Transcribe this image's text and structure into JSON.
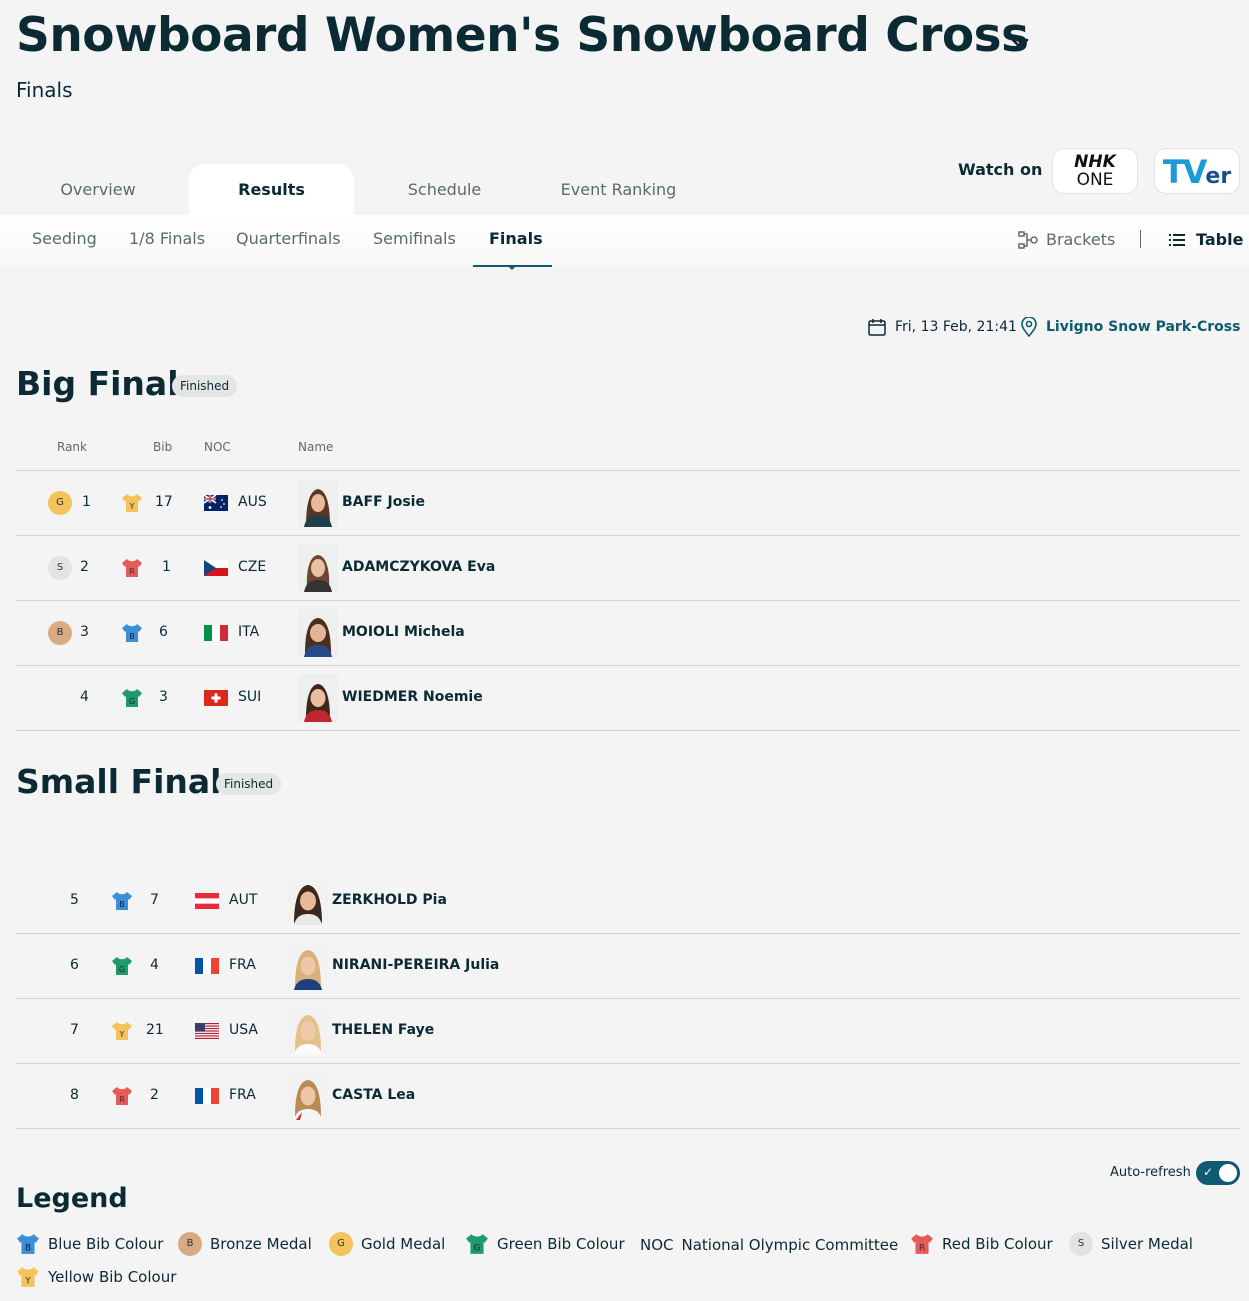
{
  "header": {
    "title": "Snowboard Women's Snowboard Cross",
    "subtitle": "Finals"
  },
  "tabs": [
    {
      "label": "Overview",
      "active": false
    },
    {
      "label": "Results",
      "active": true
    },
    {
      "label": "Schedule",
      "active": false
    },
    {
      "label": "Event Ranking",
      "active": false
    }
  ],
  "watch": {
    "label": "Watch on",
    "nhk_line1": "NHK",
    "nhk_line2": "ONE",
    "tver_t": "TV",
    "tver_er": "er"
  },
  "subtabs": [
    {
      "label": "Seeding",
      "active": false
    },
    {
      "label": "1/8 Finals",
      "active": false
    },
    {
      "label": "Quarterfinals",
      "active": false
    },
    {
      "label": "Semifinals",
      "active": false
    },
    {
      "label": "Finals",
      "active": true
    }
  ],
  "views": {
    "brackets": "Brackets",
    "table": "Table"
  },
  "meta": {
    "date": "Fri, 13 Feb, 21:41",
    "venue": "Livigno Snow Park-Cross"
  },
  "columns": {
    "rank": "Rank",
    "bib": "Bib",
    "noc": "NOC",
    "name": "Name"
  },
  "big_final": {
    "title": "Big Final",
    "status": "Finished",
    "rows": [
      {
        "medal": "G",
        "rank": "1",
        "bib_colour": "Y",
        "bib": "17",
        "noc": "AUS",
        "name": "BAFF Josie"
      },
      {
        "medal": "S",
        "rank": "2",
        "bib_colour": "R",
        "bib": "1",
        "noc": "CZE",
        "name": "ADAMCZYKOVA Eva"
      },
      {
        "medal": "B",
        "rank": "3",
        "bib_colour": "B",
        "bib": "6",
        "noc": "ITA",
        "name": "MOIOLI Michela"
      },
      {
        "medal": "",
        "rank": "4",
        "bib_colour": "G",
        "bib": "3",
        "noc": "SUI",
        "name": "WIEDMER Noemie"
      }
    ]
  },
  "small_final": {
    "title": "Small Final",
    "status": "Finished",
    "rows": [
      {
        "rank": "5",
        "bib_colour": "B",
        "bib": "7",
        "noc": "AUT",
        "name": "ZERKHOLD Pia"
      },
      {
        "rank": "6",
        "bib_colour": "G",
        "bib": "4",
        "noc": "FRA",
        "name": "NIRANI-PEREIRA Julia"
      },
      {
        "rank": "7",
        "bib_colour": "Y",
        "bib": "21",
        "noc": "USA",
        "name": "THELEN Faye"
      },
      {
        "rank": "8",
        "bib_colour": "R",
        "bib": "2",
        "noc": "FRA",
        "name": "CASTA Lea"
      }
    ]
  },
  "auto_refresh": {
    "label": "Auto-refresh",
    "on": true
  },
  "legend": {
    "title": "Legend",
    "items": [
      {
        "icon": "B",
        "label": "Blue Bib Colour"
      },
      {
        "icon": "B",
        "label": "Bronze Medal"
      },
      {
        "icon": "G",
        "label": "Gold Medal"
      },
      {
        "icon": "G",
        "label": "Green Bib Colour"
      },
      {
        "icon": "NOC",
        "label": "National Olympic Committee"
      },
      {
        "icon": "R",
        "label": "Red Bib Colour"
      },
      {
        "icon": "S",
        "label": "Silver Medal"
      },
      {
        "icon": "Y",
        "label": "Yellow Bib Colour"
      }
    ]
  },
  "colors": {
    "primary": "#0b2a33",
    "accent": "#0e5a6f",
    "gold": "#f4c45a",
    "silver": "#e2e4e3",
    "bronze": "#d9ab82",
    "bib_yellow": "#f4c45a",
    "bib_red": "#e65a5a",
    "bib_blue": "#3a8fd8",
    "bib_green": "#1f9a6b"
  }
}
